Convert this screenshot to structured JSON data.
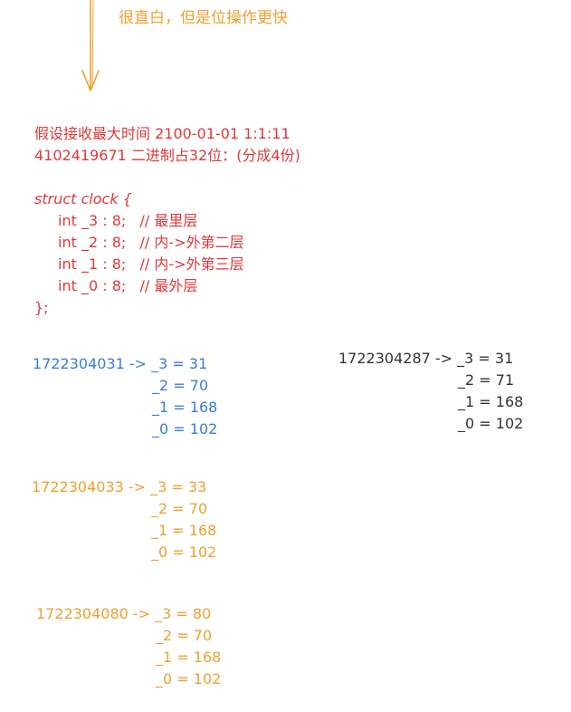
{
  "header_note": "很直白，但是位操作更快",
  "colors": {
    "orange": "#f0a030",
    "red": "#e0383a",
    "blue": "#3a7dd6",
    "dark": "#333333"
  },
  "assumption": {
    "line1": "假设接收最大时间 2100-01-01 1:1:11",
    "line2": "4102419671 二进制占32位：(分成4份)"
  },
  "struct": {
    "open": "struct clock {",
    "fields": [
      "int _3 : 8;   // 最里层",
      "int _2 : 8;   // 内->外第二层",
      "int _1 : 8;   // 内->外第三层",
      "int _0 : 8;   // 最外层"
    ],
    "close": "};"
  },
  "examples": [
    {
      "head": "1722304031 -> _3 = 31",
      "rest": [
        "_2 = 70",
        "_1 = 168",
        "_0 = 102"
      ]
    },
    {
      "head": "1722304287 -> _3 = 31",
      "rest": [
        "_2 = 71",
        "_1 = 168",
        "_0 = 102"
      ]
    },
    {
      "head": "1722304033 -> _3 = 33",
      "rest": [
        "_2 = 70",
        "_1 = 168",
        "_0 = 102"
      ]
    },
    {
      "head": "1722304080 -> _3 = 80",
      "rest": [
        "_2 = 70",
        "_1 = 168",
        "_0 = 102"
      ]
    }
  ]
}
